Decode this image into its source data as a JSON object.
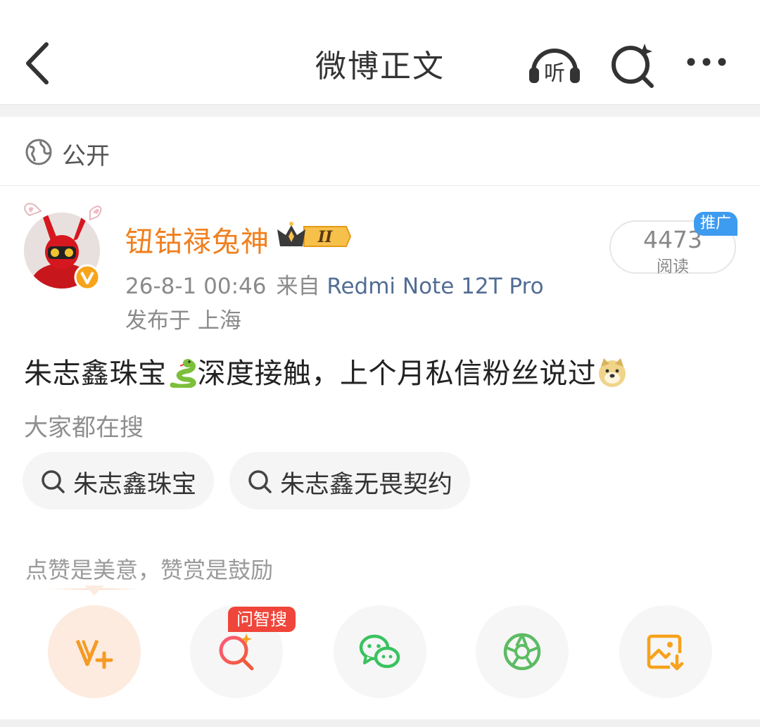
{
  "header": {
    "title": "微博正文",
    "listen_icon": "headphones-listen-icon",
    "listen_glyph": "听",
    "search_icon": "ai-search-icon",
    "more_icon": "more-dots-icon"
  },
  "visibility": {
    "label": "公开",
    "icon": "globe-icon"
  },
  "post": {
    "author": "钮钴禄兔神",
    "member_badge": "II",
    "timestamp": "26-8-1 00:46",
    "from_prefix": "来自",
    "device": "Redmi Note 12T Pro",
    "location": "发布于 上海",
    "reads": {
      "count": "4473",
      "label": "阅读",
      "promo": "推广"
    },
    "content_part1": "朱志鑫珠宝",
    "content_part2": "深度接触，上个月私信粉丝说过"
  },
  "search": {
    "hint": "大家都在搜",
    "chips": [
      {
        "label": "朱志鑫珠宝"
      },
      {
        "label": "朱志鑫无畏契约"
      }
    ]
  },
  "reward": {
    "hint": "点赞是美意，赞赏是鼓励",
    "ai_badge": "问智搜"
  },
  "colors": {
    "author": "#f07f1d",
    "device": "#526d94",
    "promo": "#3d9bf0",
    "wechat": "#3ac25f",
    "moments": "#5dbb63",
    "save": "#f7a21b",
    "ai_badge": "#f0453a"
  }
}
